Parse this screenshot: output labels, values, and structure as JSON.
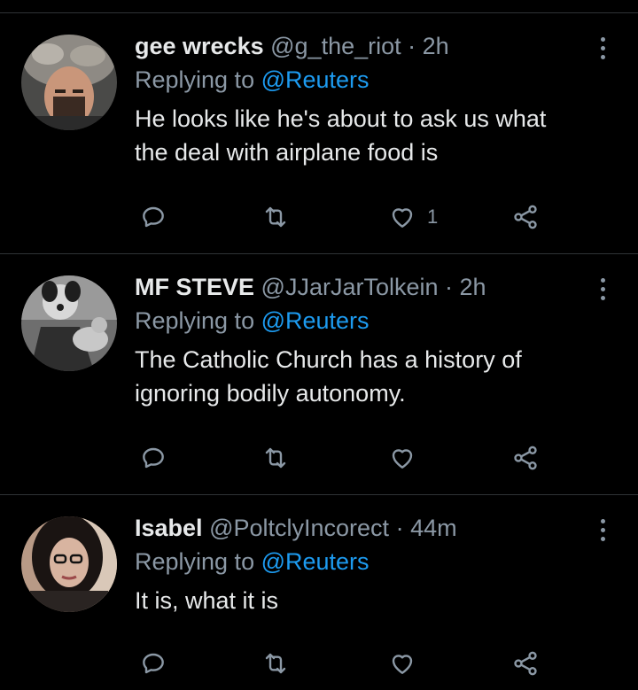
{
  "tweets": [
    {
      "name": "gee wrecks",
      "handle": "@g_the_riot",
      "separator": "·",
      "time": "2h",
      "replying_prefix": "Replying to ",
      "replying_to": "@Reuters",
      "text": "He looks like he's about to ask us what the deal with airplane food is",
      "like_count": "1"
    },
    {
      "name": "MF STEVE",
      "handle": "@JJarJarTolkein",
      "separator": "·",
      "time": "2h",
      "replying_prefix": "Replying to ",
      "replying_to": "@Reuters",
      "text": "The Catholic Church has a history of ignoring bodily autonomy.",
      "like_count": ""
    },
    {
      "name": "Isabel",
      "handle": "@PoltclyIncorect",
      "separator": "·",
      "time": "44m",
      "replying_prefix": "Replying to ",
      "replying_to": "@Reuters",
      "text": "It is, what it is",
      "like_count": ""
    }
  ],
  "icons": {
    "reply": "reply-icon",
    "retweet": "retweet-icon",
    "like": "heart-icon",
    "share": "share-icon",
    "more": "more-vertical-icon"
  },
  "colors": {
    "background": "#000000",
    "secondary_text": "#8b98a5",
    "link": "#1d9bf0",
    "divider": "#2f3336"
  }
}
